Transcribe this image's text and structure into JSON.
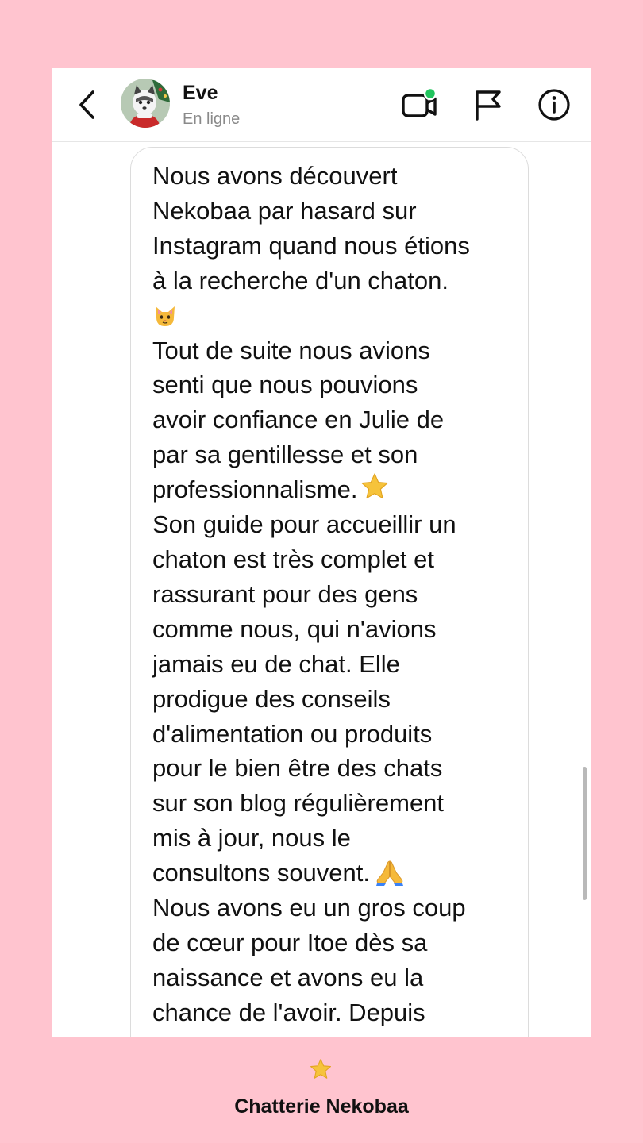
{
  "header": {
    "contact_name": "Eve",
    "contact_status": "En ligne",
    "online_color": "#22c55e",
    "icons": [
      "chevron-left-icon",
      "video-call-icon",
      "flag-icon",
      "info-icon"
    ]
  },
  "message": {
    "lines": [
      "Nous avons découvert",
      "Nekobaa par hasard sur",
      "Instagram quand nous étions",
      "à la recherche d'un chaton.",
      "",
      "Tout de suite nous avions",
      "senti que nous pouvions",
      "avoir confiance en Julie de",
      "par sa gentillesse et son",
      "professionnalisme.",
      "Son guide pour accueillir un",
      "chaton est très complet et",
      "rassurant pour des gens",
      "comme nous, qui n'avions",
      "jamais eu de chat. Elle",
      "prodigue des conseils",
      "d'alimentation ou produits",
      "pour le bien être des chats",
      "sur son blog régulièrement",
      "mis à jour, nous le",
      "consultons souvent.",
      "Nous avons eu un gros coup",
      "de cœur pour Itoe dès sa",
      "naissance et avons eu la",
      "chance de l'avoir. Depuis"
    ],
    "emojis": [
      "cat-face-icon",
      "star-icon",
      "folded-hands-icon"
    ]
  },
  "footer": {
    "title": "Chatterie Nekobaa",
    "icon": "star-icon"
  },
  "colors": {
    "background": "#ffc4cf",
    "panel": "#ffffff",
    "star": "#f6c33b"
  }
}
